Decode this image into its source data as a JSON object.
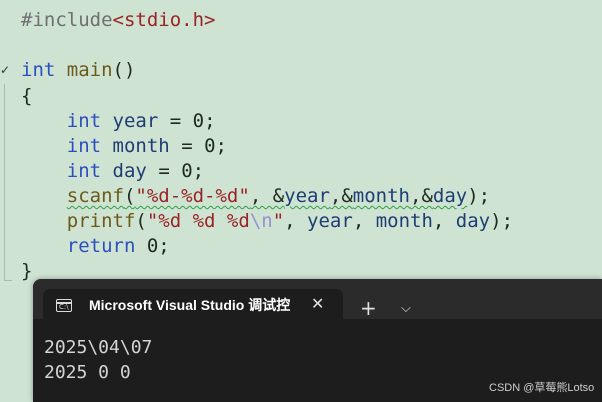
{
  "editor": {
    "lines": [
      {
        "tokens": [
          {
            "t": "#include",
            "c": "pp"
          },
          {
            "t": "<stdio.h>",
            "c": "str"
          }
        ]
      },
      {
        "tokens": []
      },
      {
        "tokens": [
          {
            "t": "int",
            "c": "kw"
          },
          {
            "t": " ",
            "c": "pun"
          },
          {
            "t": "main",
            "c": "fn"
          },
          {
            "t": "()",
            "c": "pun"
          }
        ]
      },
      {
        "tokens": [
          {
            "t": "{",
            "c": "pun"
          }
        ]
      },
      {
        "tokens": [
          {
            "t": "    ",
            "c": "pun"
          },
          {
            "t": "int",
            "c": "kw"
          },
          {
            "t": " ",
            "c": "pun"
          },
          {
            "t": "year",
            "c": "var"
          },
          {
            "t": " = 0;",
            "c": "pun"
          }
        ]
      },
      {
        "tokens": [
          {
            "t": "    ",
            "c": "pun"
          },
          {
            "t": "int",
            "c": "kw"
          },
          {
            "t": " ",
            "c": "pun"
          },
          {
            "t": "month",
            "c": "var"
          },
          {
            "t": " = 0;",
            "c": "pun"
          }
        ]
      },
      {
        "tokens": [
          {
            "t": "    ",
            "c": "pun"
          },
          {
            "t": "int",
            "c": "kw"
          },
          {
            "t": " ",
            "c": "pun"
          },
          {
            "t": "day",
            "c": "var"
          },
          {
            "t": " = 0;",
            "c": "pun"
          }
        ]
      },
      {
        "tokens": [
          {
            "t": "    ",
            "c": "pun"
          },
          {
            "t": "scanf",
            "c": "fn squig"
          },
          {
            "t": "(",
            "c": "pun squig"
          },
          {
            "t": "\"%d-%d-%d\"",
            "c": "str squig"
          },
          {
            "t": ", &",
            "c": "pun squig"
          },
          {
            "t": "year",
            "c": "var squig"
          },
          {
            "t": ",&",
            "c": "pun squig"
          },
          {
            "t": "month",
            "c": "var squig"
          },
          {
            "t": ",&",
            "c": "pun squig"
          },
          {
            "t": "day",
            "c": "var squig"
          },
          {
            "t": ");",
            "c": "pun"
          }
        ]
      },
      {
        "tokens": [
          {
            "t": "    ",
            "c": "pun"
          },
          {
            "t": "printf",
            "c": "fn"
          },
          {
            "t": "(",
            "c": "pun"
          },
          {
            "t": "\"%d %d %d",
            "c": "str"
          },
          {
            "t": "\\n",
            "c": "esc"
          },
          {
            "t": "\"",
            "c": "str"
          },
          {
            "t": ", ",
            "c": "pun"
          },
          {
            "t": "year",
            "c": "var"
          },
          {
            "t": ", ",
            "c": "pun"
          },
          {
            "t": "month",
            "c": "var"
          },
          {
            "t": ", ",
            "c": "pun"
          },
          {
            "t": "day",
            "c": "var"
          },
          {
            "t": ");",
            "c": "pun"
          }
        ]
      },
      {
        "tokens": [
          {
            "t": "    ",
            "c": "pun"
          },
          {
            "t": "return",
            "c": "kw"
          },
          {
            "t": " 0;",
            "c": "pun"
          }
        ]
      },
      {
        "tokens": [
          {
            "t": "}",
            "c": "pun"
          }
        ]
      }
    ],
    "fold_marker": "✓"
  },
  "console": {
    "tab_icon_label": "C:\\",
    "tab_title": "Microsoft Visual Studio 调试控",
    "close_glyph": "✕",
    "new_tab_glyph": "+",
    "dropdown_glyph": "⌵",
    "output_lines": [
      "2025\\04\\07",
      "2025 0 0"
    ]
  },
  "watermark": "CSDN @草莓熊Lotso"
}
